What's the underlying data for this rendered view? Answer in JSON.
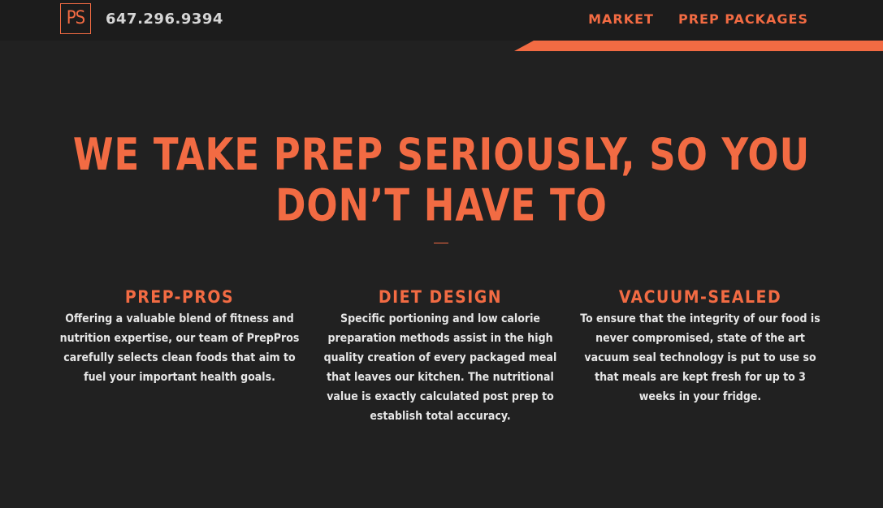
{
  "header": {
    "logo_text": "PS",
    "phone": "647.296.9394",
    "nav": [
      {
        "label": "MARKET"
      },
      {
        "label": "PREP PACKAGES"
      }
    ]
  },
  "hero": {
    "title": "WE TAKE PREP SERIOUSLY, SO YOU DON’T HAVE TO"
  },
  "features": [
    {
      "title": "PREP-PROS",
      "text": "Offering a valuable blend of fitness and nutrition expertise, our team of PrepPros carefully selects clean foods that aim to fuel your important health goals."
    },
    {
      "title": "DIET DESIGN",
      "text": "Specific portioning and low calorie preparation methods assist in the high quality creation of every packaged meal that leaves our kitchen. The nutritional value is exactly calculated post prep to establish total accuracy."
    },
    {
      "title": "VACUUM-SEALED",
      "text": "To ensure that the integrity of our food is never compromised, state of the art vacuum seal technology is put to use so that meals are kept fresh for up to 3 weeks in your fridge."
    }
  ],
  "colors": {
    "accent": "#f26b43",
    "background": "#212121",
    "header_bg": "#1c1c1c",
    "text": "#e6e6e6"
  }
}
